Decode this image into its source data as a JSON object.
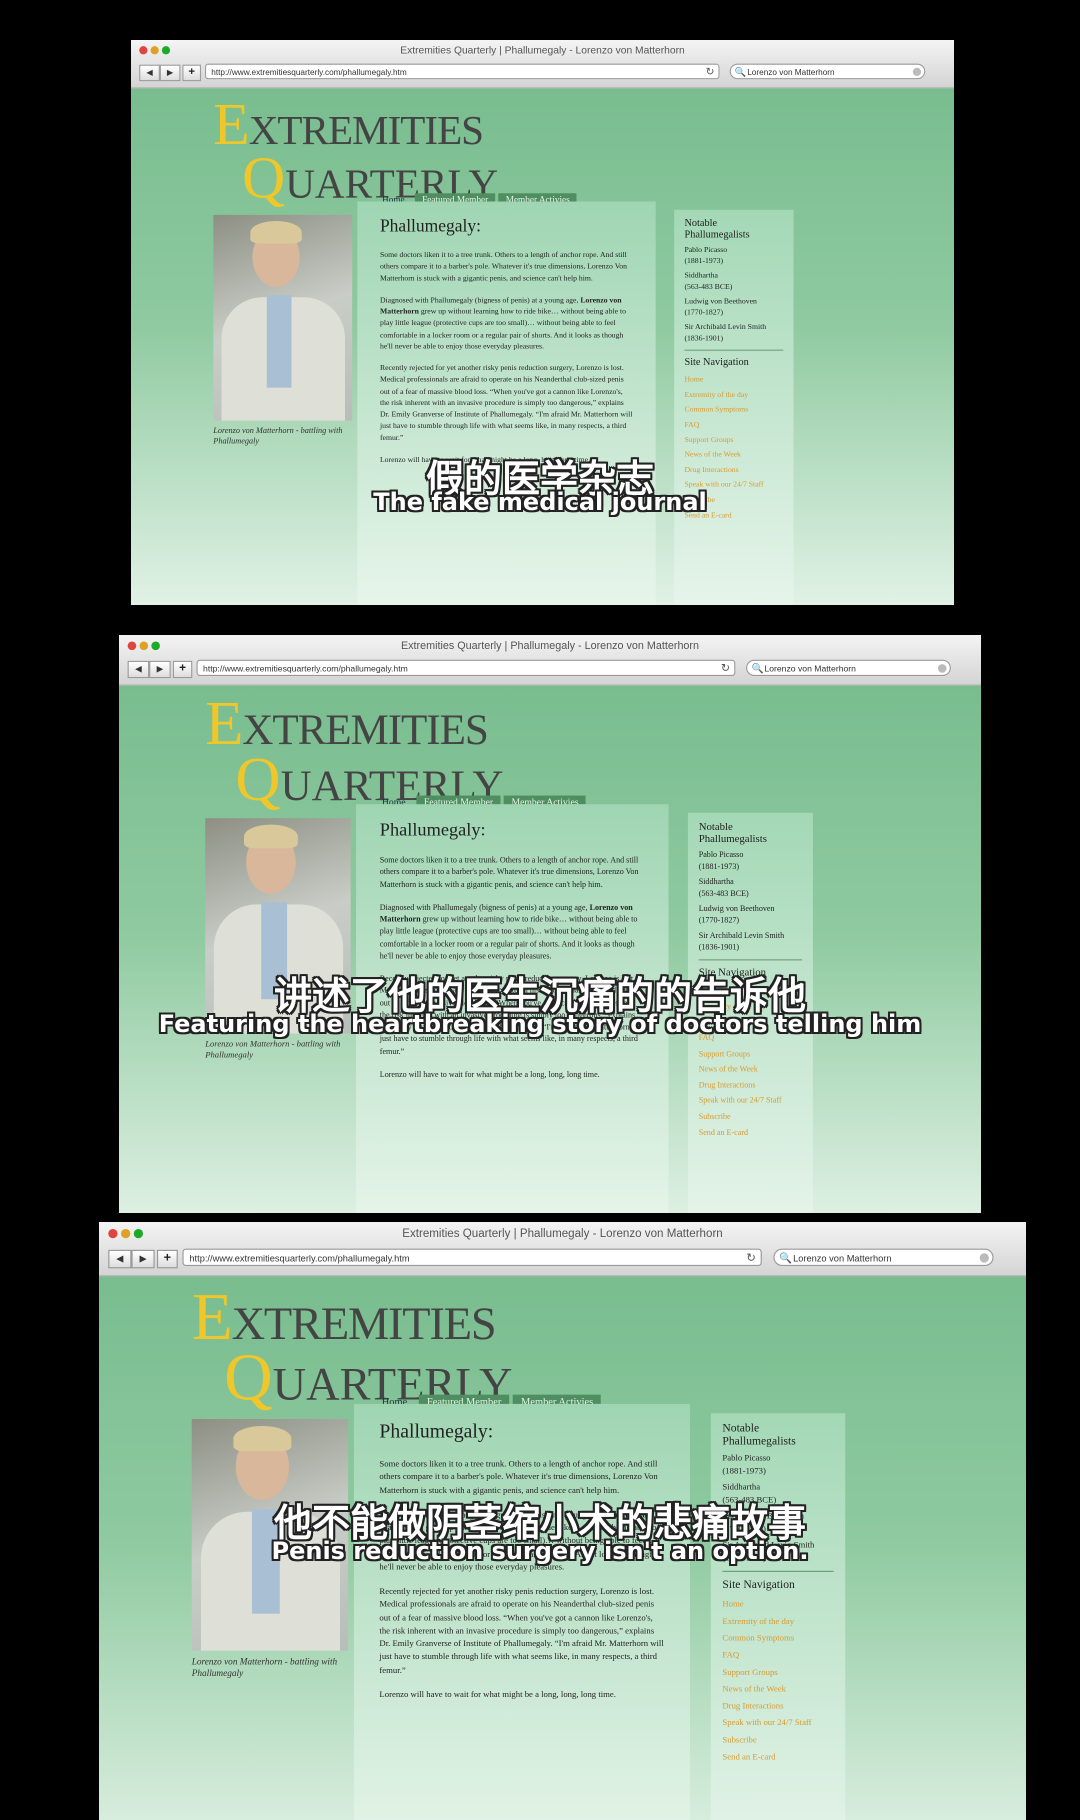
{
  "browser": {
    "window_title": "Extremities Quarterly | Phallumegaly - Lorenzo von Matterhorn",
    "url": "http://www.extremitiesquarterly.com/phallumegaly.htm",
    "search_text": "Lorenzo von Matterhorn",
    "back_glyph": "◀",
    "forward_glyph": "▶",
    "plus_glyph": "+",
    "reload_glyph": "↻",
    "search_glyph": "🔍"
  },
  "site": {
    "logo_line1_cap": "E",
    "logo_line1_rest": "XTREMITIES",
    "logo_line2_cap": "Q",
    "logo_line2_rest": "UARTERLY",
    "tabs": [
      {
        "label": "Home"
      },
      {
        "label": "Featured Member"
      },
      {
        "label": "Member Activies"
      }
    ],
    "photo_caption": "Lorenzo von Matterhorn - battling with Phallumegaly",
    "article": {
      "heading": "Phallumegaly:",
      "p1": "Some doctors liken it to a tree trunk.  Others to a length of anchor rope. And still others compare it to a barber's pole.  Whatever it's true dimensions, Lorenzo Von Matterhorn is stuck with a gigantic penis, and science can't help him.",
      "p2_before": "Diagnosed with Phallumegaly (bigness of penis) at a young age, ",
      "p2_bold": "Lorenzo von Matterhorn",
      "p2_after": " grew up without learning how to ride bike… without being able to play little league (protective cups are too small)… without being able to feel comfortable in a locker room or a regular pair of shorts.  And it looks as though he'll never be able to enjoy those everyday pleasures.",
      "p3": "Recently rejected for yet another risky penis reduction surgery, Lorenzo is lost.  Medical professionals are afraid to operate on his Neanderthal club-sized penis out of a fear of massive blood loss.  “When you've got a cannon like Lorenzo's, the risk inherent with an invasive procedure is simply too dangerous,” explains Dr. Emily Granverse of Institute of Phallumegaly.  “I'm afraid Mr. Matterhorn will just have to stumble through life with what seems like, in many respects, a third femur.”",
      "p4": "Lorenzo will have to wait for what might be a long, long, long time."
    },
    "sidebar": {
      "notable_title": "Notable Phallumegalists",
      "notable": [
        {
          "name": "Pablo Picasso",
          "years": "(1881-1973)"
        },
        {
          "name": "Siddhartha",
          "years": "(563-483 BCE)"
        },
        {
          "name": "Ludwig von Beethoven",
          "years": "(1770-1827)"
        },
        {
          "name": "Sir Archibald Levin Smith",
          "years": "(1836-1901)"
        }
      ],
      "nav_title": "Site Navigation",
      "nav_links": [
        {
          "label": "Home"
        },
        {
          "label": "Extremity of the day"
        },
        {
          "label": "Common Symptoms"
        },
        {
          "label": "FAQ"
        },
        {
          "label": "Support Groups"
        },
        {
          "label": "News of the Week"
        },
        {
          "label": "Drug Interactions"
        },
        {
          "label": "Speak with our 24/7 Staff"
        },
        {
          "label": "Subscribe"
        },
        {
          "label": "Send an E-card"
        }
      ]
    }
  },
  "subtitles": [
    {
      "cn": "假的医学杂志",
      "en": "The fake medical journal"
    },
    {
      "cn": "讲述了他的医生沉痛的的告诉他",
      "en": "Featuring the heartbreaking story of doctors telling him"
    },
    {
      "cn": "他不能做阴茎缩小术的悲痛故事",
      "en": "Penis reduction surgery isn't an option."
    }
  ],
  "colors": {
    "page_green": "#79bd8f",
    "logo_gold": "#f0c72a",
    "nav_link_orange": "#d99a2e",
    "tab_green": "#4e8e61"
  }
}
